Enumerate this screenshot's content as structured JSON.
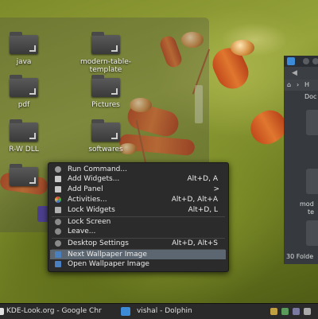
{
  "desktop": {
    "icons": [
      {
        "label": "java"
      },
      {
        "label": "modern-table-template"
      },
      {
        "label": "pdf"
      },
      {
        "label": "Pictures"
      },
      {
        "label": "R-W DLL"
      },
      {
        "label": "softwares"
      }
    ]
  },
  "context_menu": {
    "items": [
      {
        "label": "Run Command...",
        "shortcut": ""
      },
      {
        "label": "Add Widgets...",
        "shortcut": "Alt+D, A"
      },
      {
        "label": "Add Panel",
        "shortcut": ">"
      },
      {
        "label": "Activities...",
        "shortcut": "Alt+D, Alt+A"
      },
      {
        "label": "Lock Widgets",
        "shortcut": "Alt+D, L"
      },
      {
        "label": "Lock Screen",
        "shortcut": ""
      },
      {
        "label": "Leave...",
        "shortcut": ""
      },
      {
        "label": "Desktop Settings",
        "shortcut": "Alt+D, Alt+S"
      },
      {
        "label": "Next Wallpaper Image",
        "shortcut": ""
      },
      {
        "label": "Open Wallpaper Image",
        "shortcut": ""
      }
    ],
    "highlighted_item": "Next Wallpaper Image"
  },
  "dolphin_fragment": {
    "breadcrumb": "H",
    "text_1": "Doc",
    "text_2": "mod",
    "text_3": "te",
    "status": "30 Folde"
  },
  "taskbar": {
    "tasks": [
      {
        "label": "KDE-Look.org - Google Chr",
        "icon": "chrome-icon"
      },
      {
        "label": "vishal - Dolphin",
        "icon": "dolphin-icon"
      }
    ]
  },
  "colors": {
    "menu_bg": "#2b2b2b",
    "menu_highlight": "#5c6670",
    "taskbar_bg": "#2a2a2a",
    "dolphin_accent": "#3d8ad6"
  }
}
